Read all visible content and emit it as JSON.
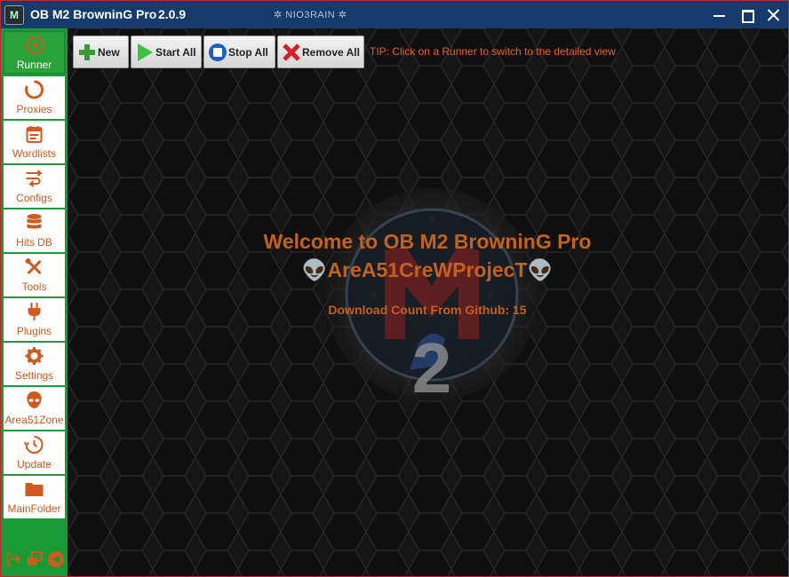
{
  "window": {
    "icon_text": "M",
    "title": "OB M2 BrowninG Pro",
    "version": "2.0.9",
    "tag": "✲ NIO3RAIN ✲"
  },
  "colors": {
    "titlebar": "#153a6b",
    "sidebar": "#1a9a34",
    "accent": "#cf5a1e",
    "welcome_text": "#c2621c"
  },
  "sidebar": {
    "items": [
      {
        "label": "Runner",
        "icon": "play-circle-icon",
        "active": true
      },
      {
        "label": "Proxies",
        "icon": "refresh-circle-icon"
      },
      {
        "label": "Wordlists",
        "icon": "notepad-icon"
      },
      {
        "label": "Configs",
        "icon": "swap-arrows-icon"
      },
      {
        "label": "Hits DB",
        "icon": "database-icon"
      },
      {
        "label": "Tools",
        "icon": "wrench-screwdriver-icon"
      },
      {
        "label": "Plugins",
        "icon": "plug-icon"
      },
      {
        "label": "Settings",
        "icon": "gear-icon"
      },
      {
        "label": "Area51Zone",
        "icon": "alien-icon"
      },
      {
        "label": "Update",
        "icon": "clock-update-icon"
      },
      {
        "label": "MainFolder",
        "icon": "folder-icon"
      }
    ],
    "bottom_icons": [
      "logout-icon",
      "windows-icon",
      "telegram-icon"
    ]
  },
  "toolbar": {
    "new_label": "New",
    "start_all_label": "Start All",
    "stop_all_label": "Stop All",
    "remove_all_label": "Remove All",
    "tip": "TIP: Click on a Runner to switch to the detailed view"
  },
  "welcome": {
    "title": "Welcome to OB M2 BrowninG Pro",
    "subtitle": "👽AreA51CreWProjecT👽",
    "download_count": "Download Count From Github: 15"
  }
}
